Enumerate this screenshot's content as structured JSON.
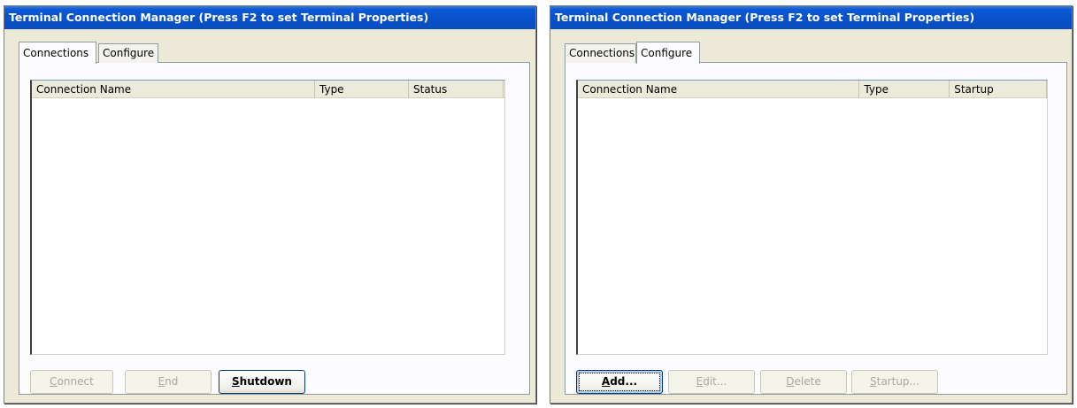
{
  "left_window": {
    "title": "Terminal Connection Manager (Press F2 to set Terminal Properties)",
    "tabs": [
      {
        "label": "Connections",
        "active": true
      },
      {
        "label": "Configure",
        "active": false
      }
    ],
    "list": {
      "columns": [
        "Connection Name",
        "Type",
        "Status"
      ],
      "rows": []
    },
    "buttons": [
      {
        "accel": "C",
        "rest": "onnect",
        "enabled": false
      },
      {
        "accel": "E",
        "rest": "nd",
        "enabled": false
      },
      {
        "accel": "S",
        "rest": "hutdown",
        "enabled": true
      }
    ]
  },
  "right_window": {
    "title": "Terminal Connection Manager (Press F2 to set Terminal Properties)",
    "tabs": [
      {
        "label": "Connections",
        "active": false
      },
      {
        "label": "Configure",
        "active": true
      }
    ],
    "list": {
      "columns": [
        "Connection Name",
        "Type",
        "Startup"
      ],
      "rows": []
    },
    "buttons": [
      {
        "accel": "A",
        "rest": "dd...",
        "enabled": true
      },
      {
        "accel": "E",
        "rest": "dit...",
        "enabled": false
      },
      {
        "accel": "D",
        "rest": "elete",
        "enabled": false
      },
      {
        "accel": "S",
        "rest": "tartup...",
        "enabled": false
      }
    ]
  },
  "colors": {
    "titlebar": "#0850c8",
    "window_bg": "#ece9d8",
    "panel_bg": "#fcfcfe",
    "disabled_text": "#aca899",
    "button_border": "#003c74"
  }
}
